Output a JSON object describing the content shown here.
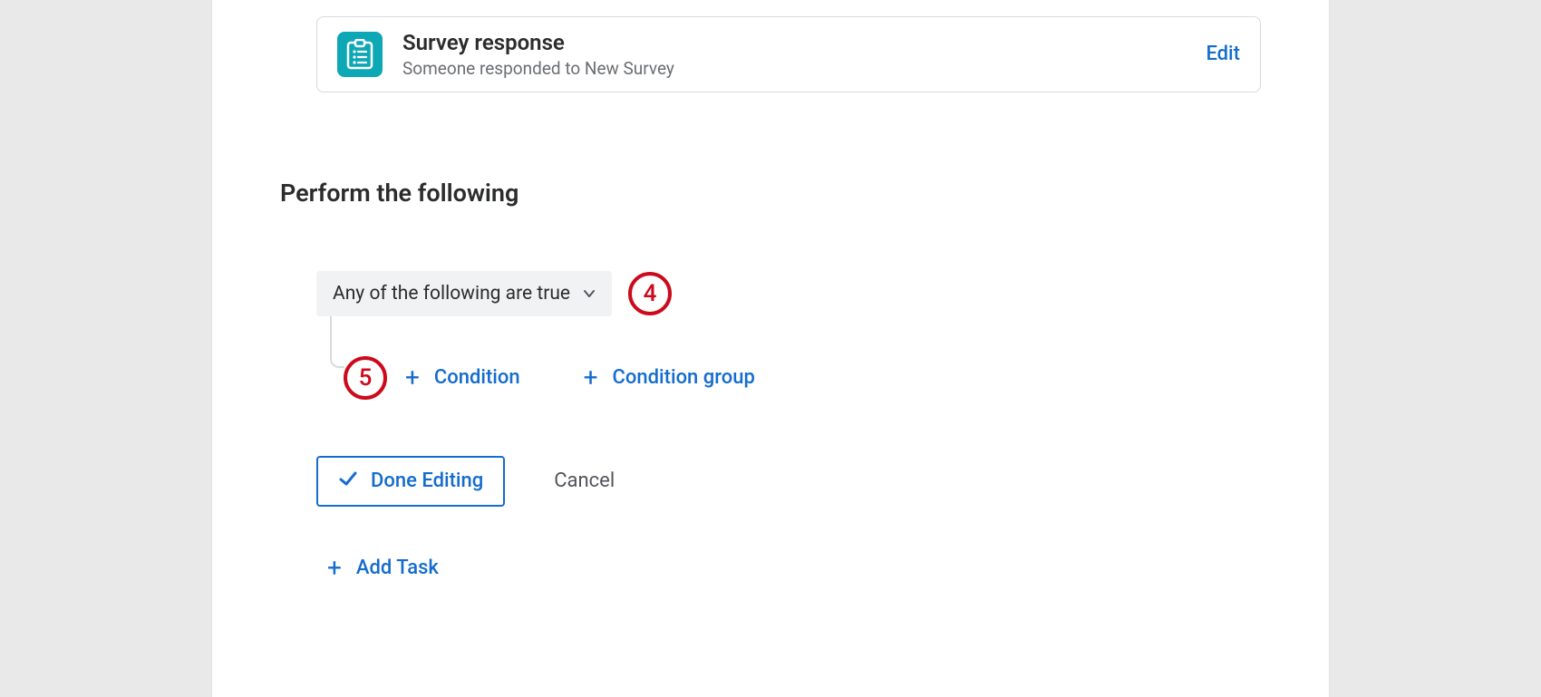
{
  "trigger": {
    "title": "Survey response",
    "subtitle": "Someone responded to New Survey",
    "edit_label": "Edit"
  },
  "section": {
    "heading": "Perform the following"
  },
  "condition": {
    "dropdown_label": "Any of the following are true",
    "add_condition_label": "Condition",
    "add_condition_group_label": "Condition group"
  },
  "actions": {
    "done_label": "Done Editing",
    "cancel_label": "Cancel",
    "add_task_label": "Add Task"
  },
  "annotations": {
    "marker_4": "4",
    "marker_5": "5"
  }
}
